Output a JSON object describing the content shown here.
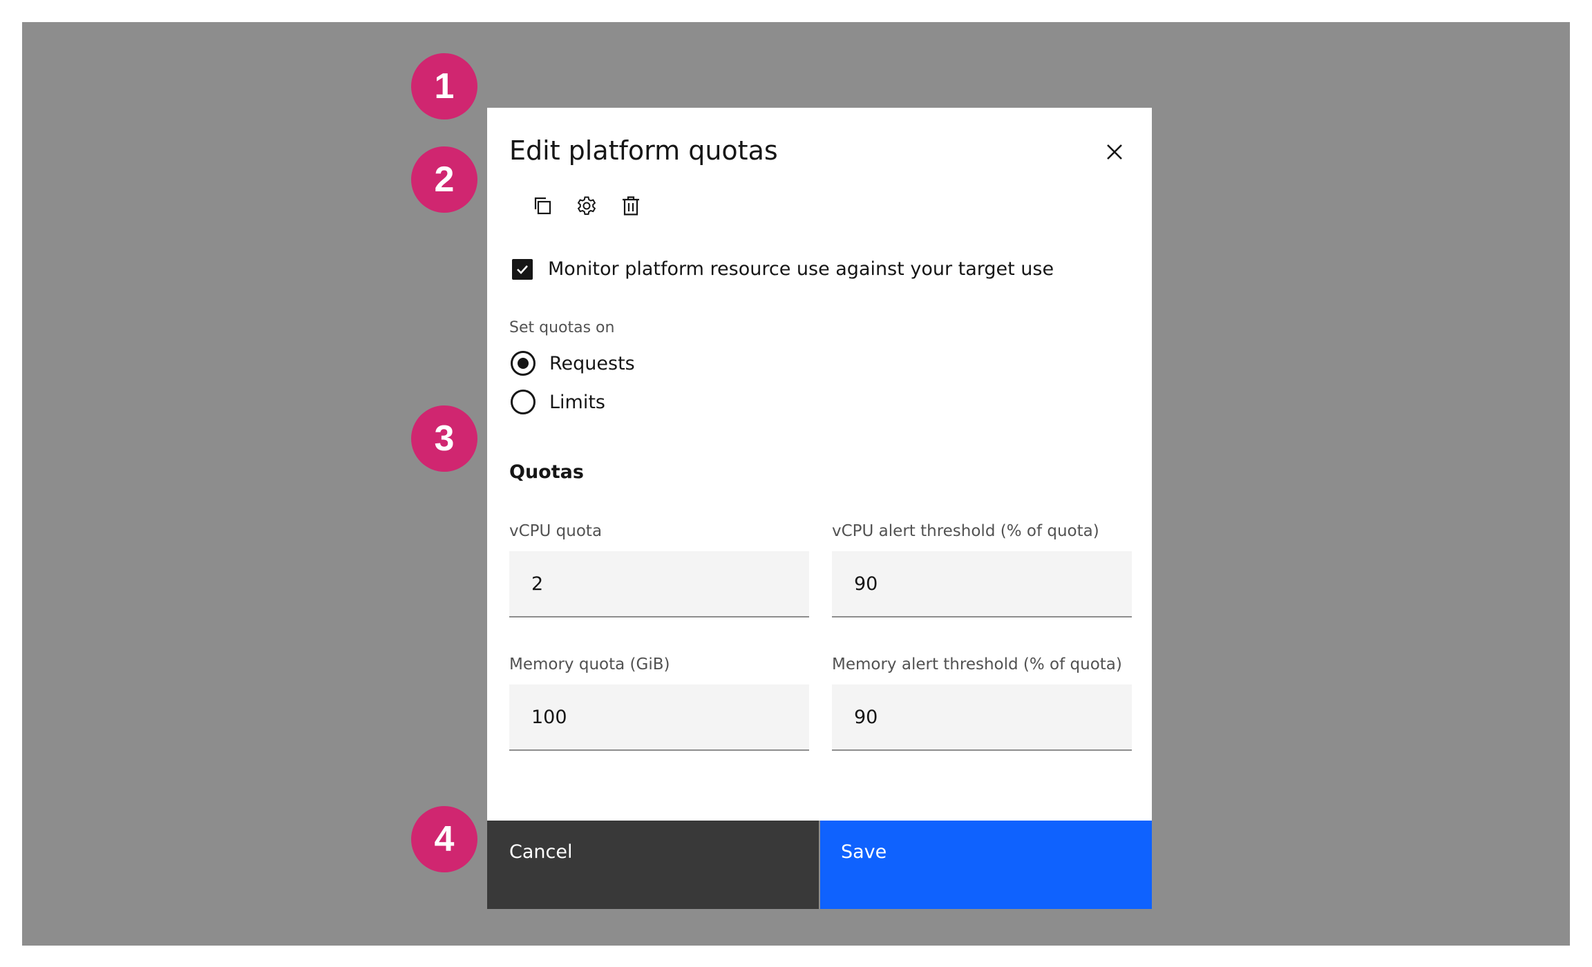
{
  "modal": {
    "title": "Edit platform quotas",
    "toolbar": {
      "icons": [
        "copy-icon",
        "settings-icon",
        "trash-icon"
      ]
    },
    "checkbox": {
      "label": "Monitor platform resource use against your target use",
      "checked": true
    },
    "radio_group": {
      "label": "Set quotas on",
      "options": [
        {
          "label": "Requests",
          "selected": true
        },
        {
          "label": "Limits",
          "selected": false
        }
      ]
    },
    "section_heading": "Quotas",
    "fields": [
      {
        "label": "vCPU quota",
        "value": "2"
      },
      {
        "label": "vCPU alert threshold (% of quota)",
        "value": "90"
      },
      {
        "label": "Memory quota (GiB)",
        "value": "100"
      },
      {
        "label": "Memory alert threshold (% of quota)",
        "value": "90"
      }
    ],
    "footer": {
      "cancel_label": "Cancel",
      "save_label": "Save"
    }
  },
  "markers": [
    "1",
    "2",
    "3",
    "4"
  ],
  "colors": {
    "overlay": "#8d8d8d",
    "marker": "#d02670",
    "primary": "#0f62fe",
    "secondary": "#393939"
  }
}
